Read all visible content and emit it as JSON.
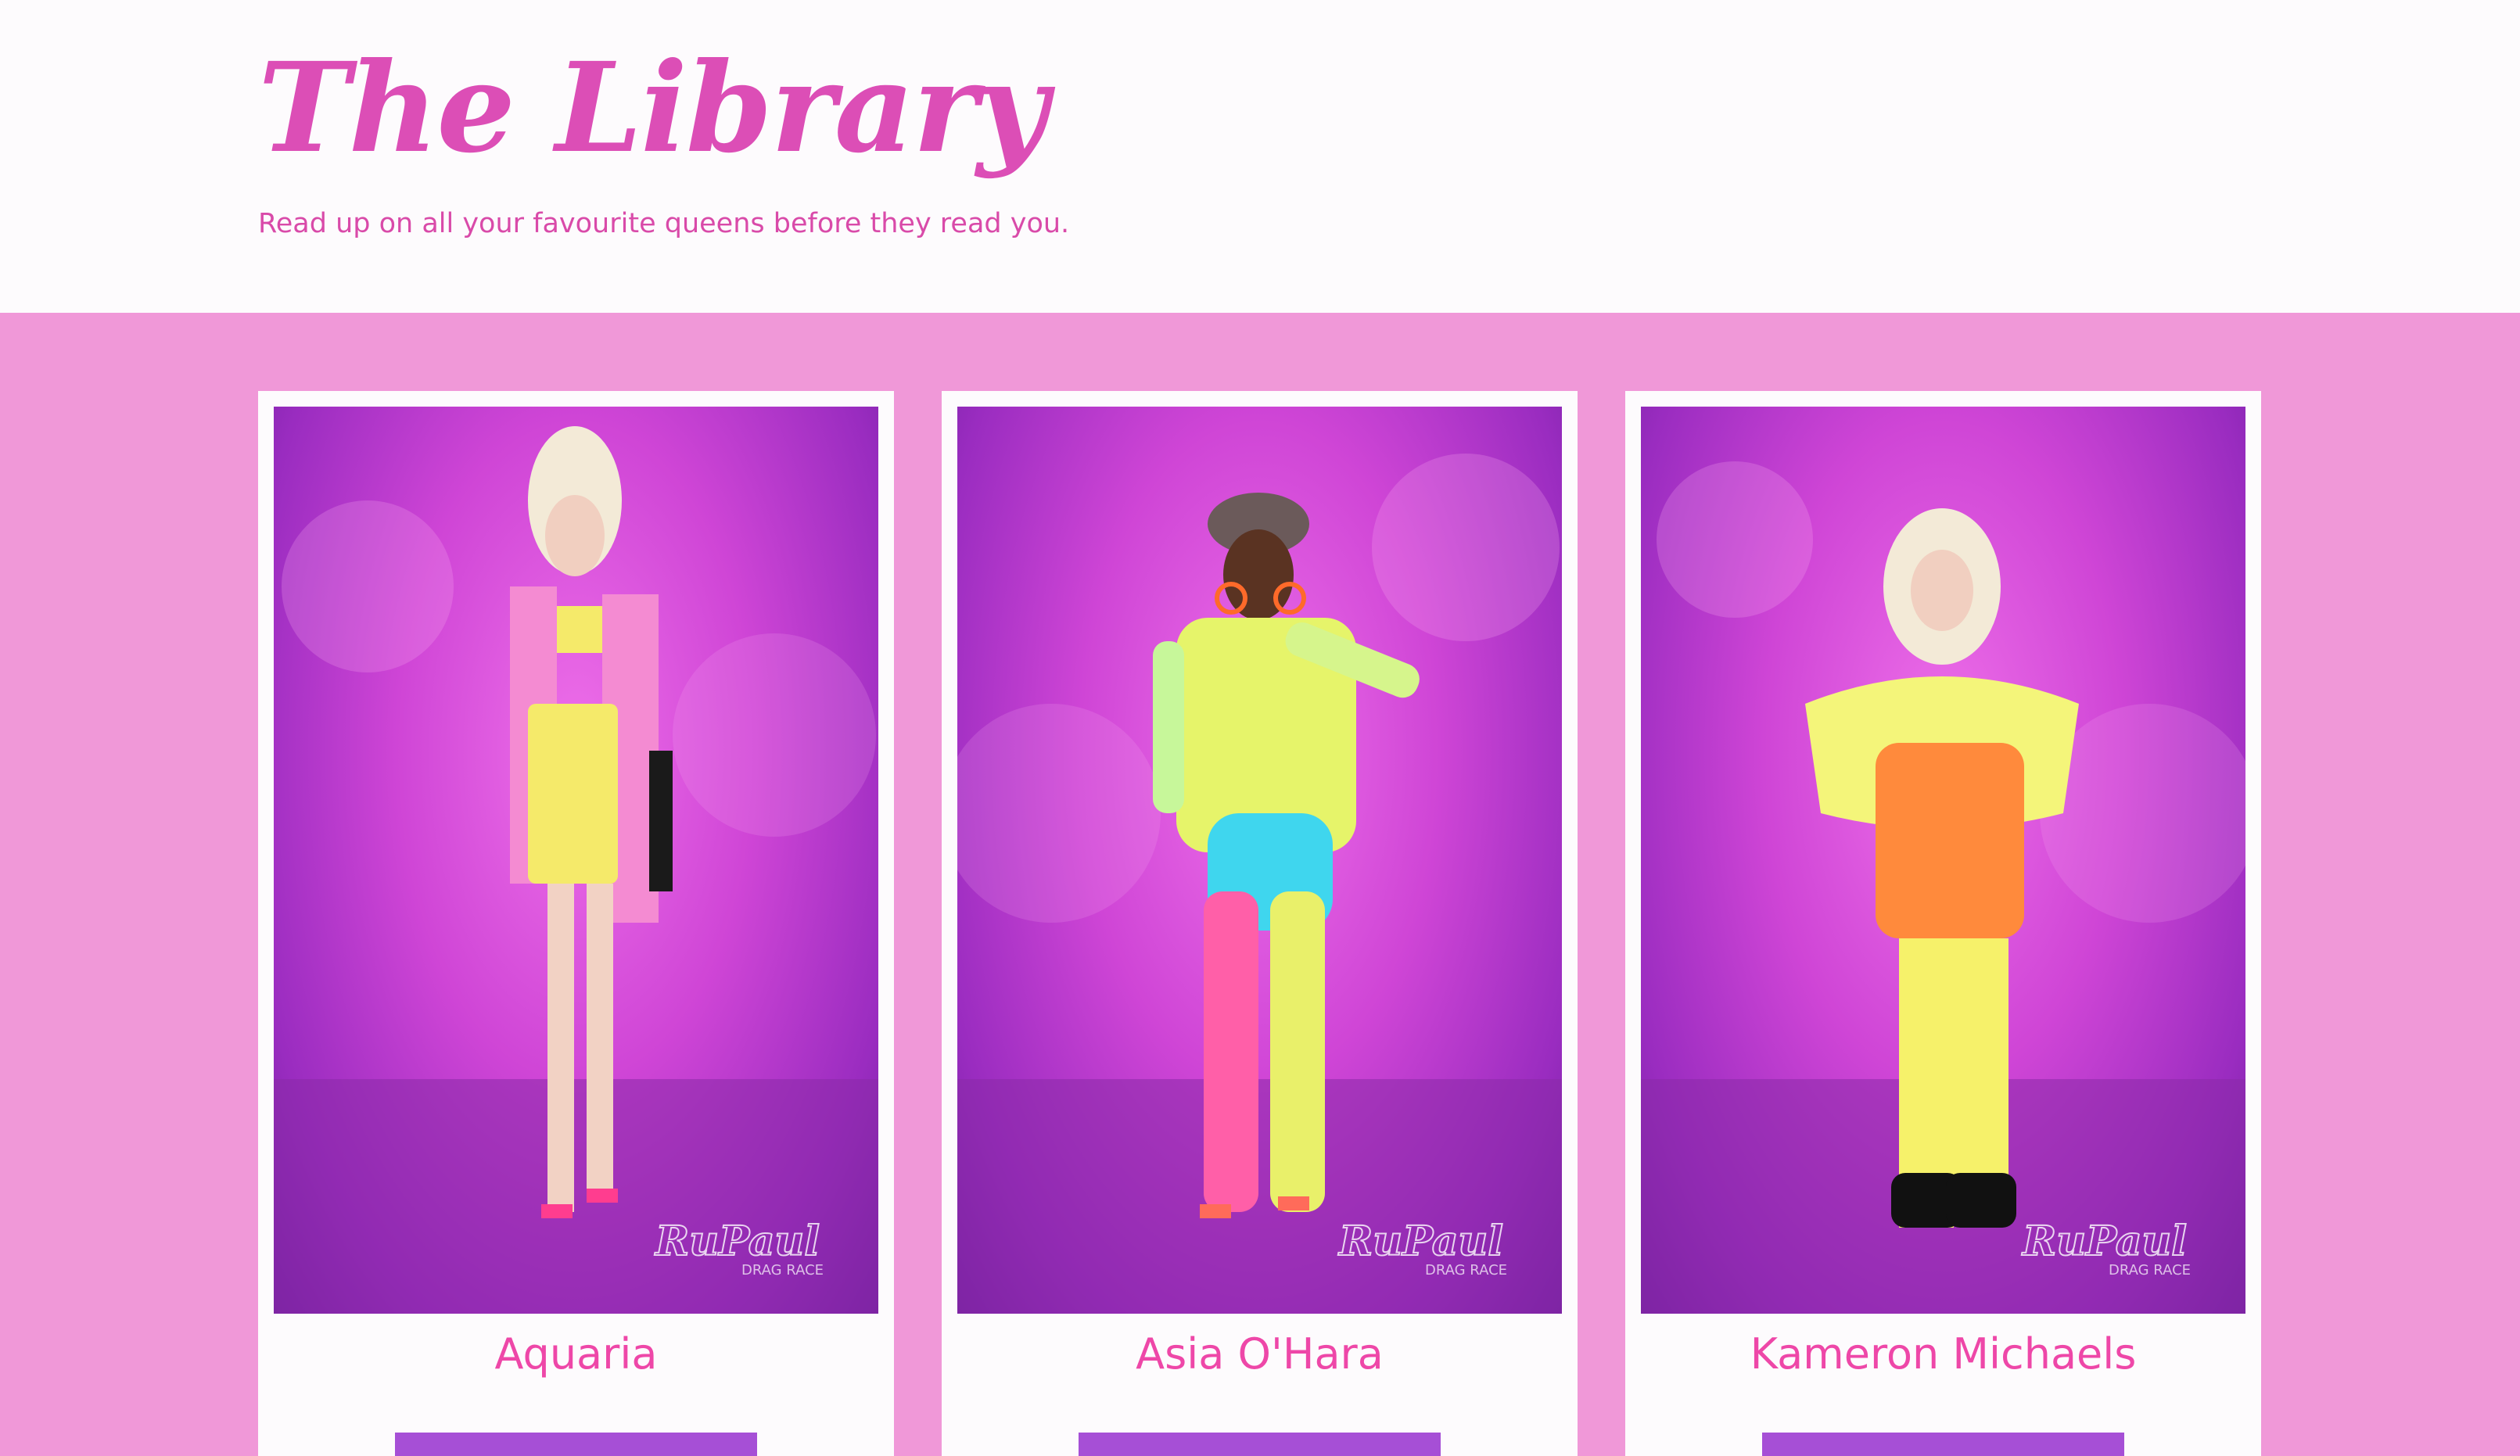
{
  "header": {
    "title": "The Library",
    "subtitle": "Read up on all your favourite queens before they read you."
  },
  "queens": [
    {
      "name": "Aquaria",
      "watermark": "RuPaul's DRAG RACE",
      "outfit_colors": [
        "#f5ea6a",
        "#f48bd2",
        "#1a1a1a"
      ]
    },
    {
      "name": "Asia O'Hara",
      "watermark": "RuPaul's DRAG RACE",
      "outfit_colors": [
        "#e6f46a",
        "#3fd6ee",
        "#ff5fa8"
      ]
    },
    {
      "name": "Kameron Michaels",
      "watermark": "RuPaul's DRAG RACE",
      "outfit_colors": [
        "#f4f57a",
        "#ff8a3c",
        "#111111"
      ]
    }
  ],
  "colors": {
    "accent": "#dc4eb6",
    "band_background": "#f098d8",
    "card_background": "#fdfbfd",
    "button": "#a64fd6"
  }
}
